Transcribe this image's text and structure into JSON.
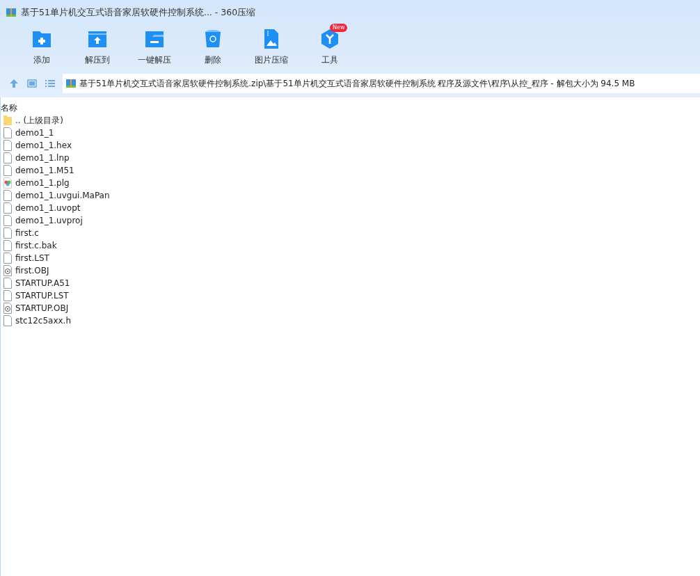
{
  "window": {
    "title": "基于51单片机交互式语音家居软硬件控制系统... - 360压缩"
  },
  "toolbar": [
    {
      "kind": "add",
      "label": "添加"
    },
    {
      "kind": "extract",
      "label": "解压到"
    },
    {
      "kind": "oneclick",
      "label": "一键解压"
    },
    {
      "kind": "delete",
      "label": "删除"
    },
    {
      "kind": "image",
      "label": "图片压缩"
    },
    {
      "kind": "tools",
      "label": "工具",
      "badge": "New"
    }
  ],
  "path": {
    "value": "基于51单片机交互式语音家居软硬件控制系统.zip\\基于51单片机交互式语音家居软硬件控制系统 程序及源文件\\程序\\从控_程序 - 解包大小为 94.5 MB"
  },
  "table": {
    "columns": [
      "名称"
    ],
    "rows": [
      {
        "kind": "folder",
        "name": ".. (上级目录)"
      },
      {
        "kind": "file",
        "name": "demo1_1"
      },
      {
        "kind": "file",
        "name": "demo1_1.hex"
      },
      {
        "kind": "file",
        "name": "demo1_1.lnp"
      },
      {
        "kind": "file",
        "name": "demo1_1.M51"
      },
      {
        "kind": "color",
        "name": "demo1_1.plg"
      },
      {
        "kind": "file",
        "name": "demo1_1.uvgui.MaPan"
      },
      {
        "kind": "file",
        "name": "demo1_1.uvopt"
      },
      {
        "kind": "file",
        "name": "demo1_1.uvproj"
      },
      {
        "kind": "file",
        "name": "first.c"
      },
      {
        "kind": "file",
        "name": "first.c.bak"
      },
      {
        "kind": "file",
        "name": "first.LST"
      },
      {
        "kind": "object",
        "name": "first.OBJ"
      },
      {
        "kind": "file",
        "name": "STARTUP.A51"
      },
      {
        "kind": "file",
        "name": "STARTUP.LST"
      },
      {
        "kind": "object",
        "name": "STARTUP.OBJ"
      },
      {
        "kind": "file",
        "name": "stc12c5axx.h"
      }
    ]
  }
}
